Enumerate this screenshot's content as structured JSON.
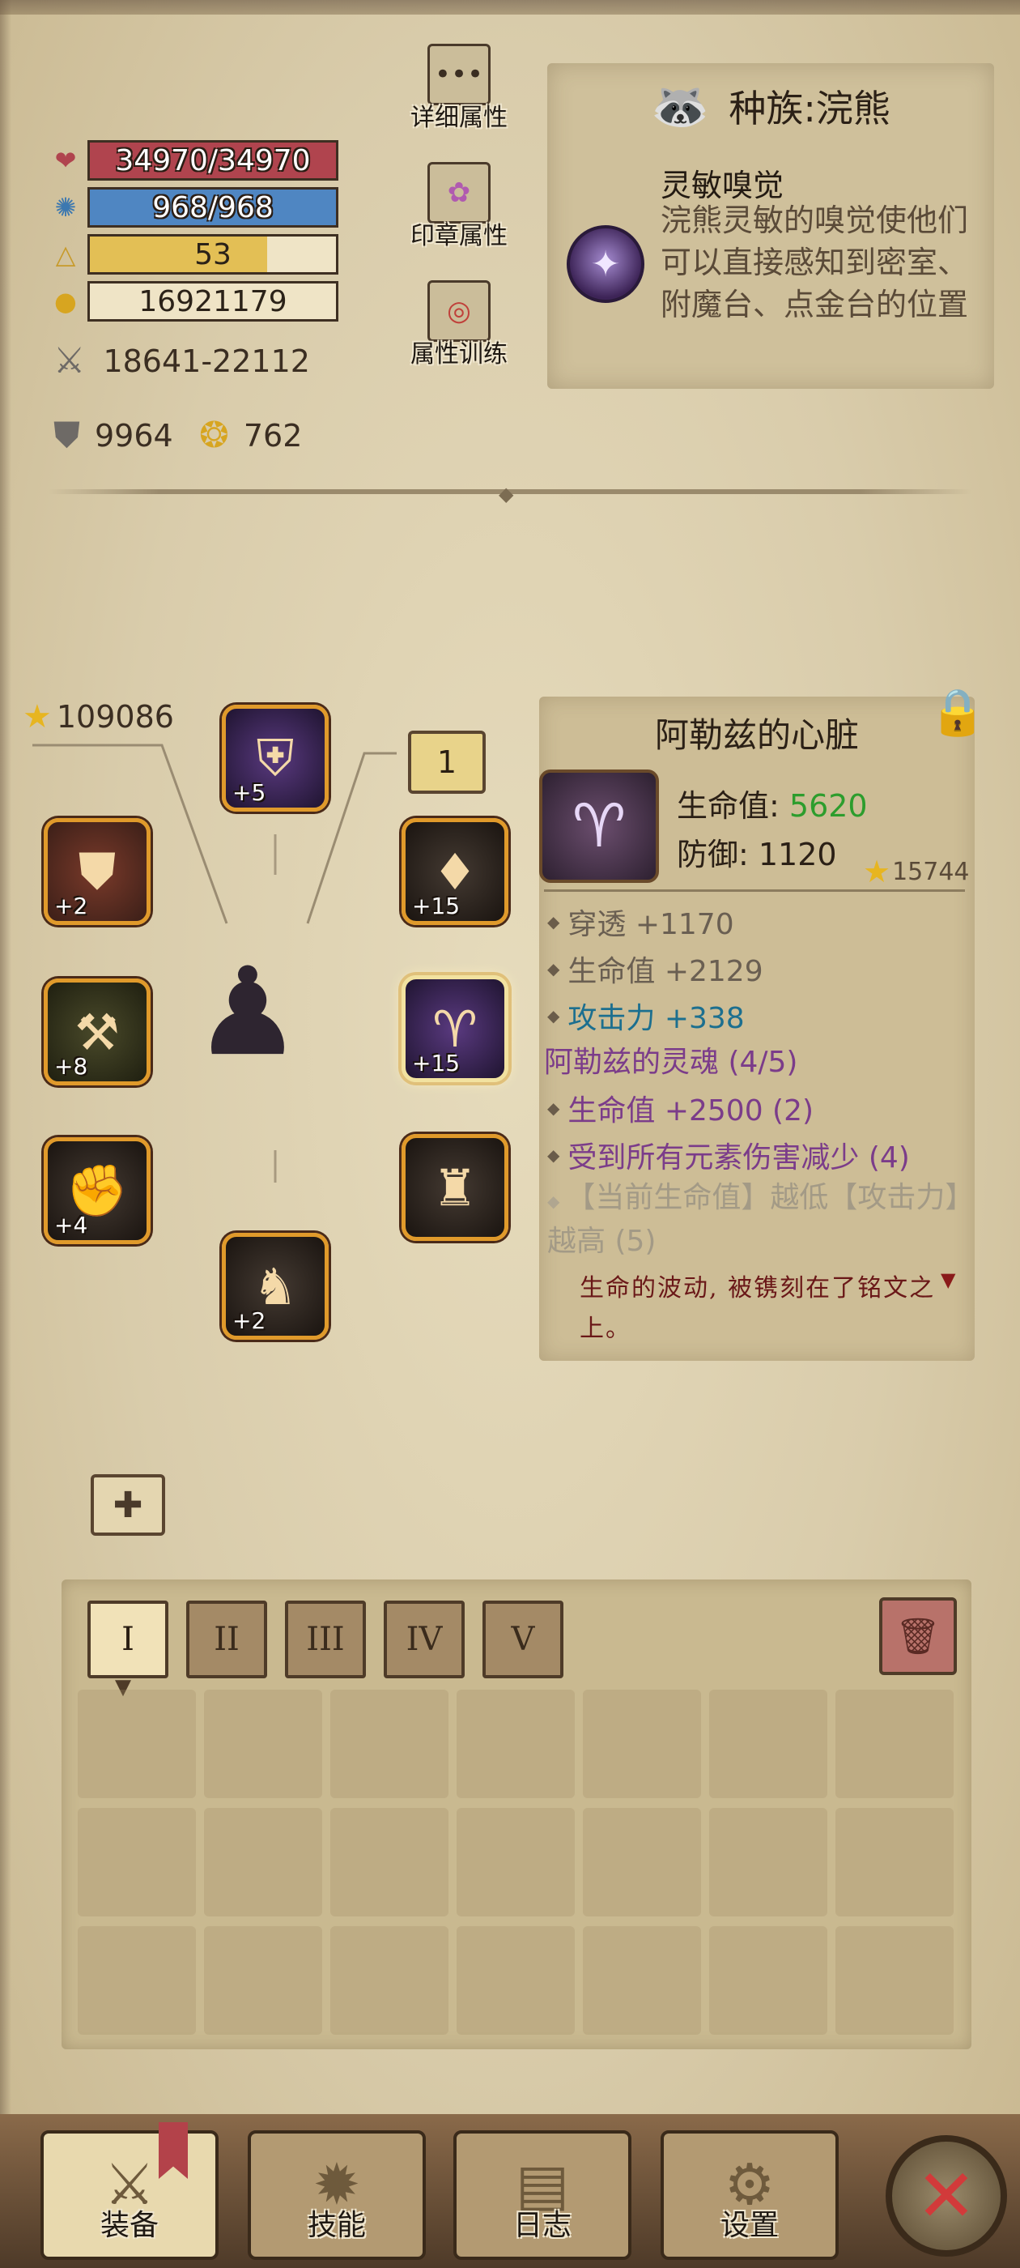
{
  "stats": {
    "hp": {
      "icon": "heart-icon",
      "text": "34970/34970",
      "fill": 1.0,
      "color": "#b0444e"
    },
    "mp": {
      "icon": "sparkle-icon",
      "text": "968/968",
      "fill": 1.0,
      "color": "#4f86c2"
    },
    "level": {
      "icon": "triangle-icon",
      "text": "53",
      "fill": 0.72,
      "color": "#e3bf55"
    },
    "gold": {
      "icon": "gold-icon",
      "text": "16921179"
    },
    "attack": {
      "icon": "crossed-swords-icon",
      "text": "18641-22112"
    },
    "defense": {
      "icon": "shield-icon",
      "text": "9964"
    },
    "crit": {
      "icon": "coin-flame-icon",
      "text": "762"
    }
  },
  "side_buttons": {
    "detail": {
      "label": "详细属性",
      "icon": "dots-icon"
    },
    "seal": {
      "label": "印章属性",
      "icon": "flower-seal-icon"
    },
    "train": {
      "label": "属性训练",
      "icon": "target-icon"
    }
  },
  "race": {
    "title": "种族:浣熊",
    "icon": "raccoon-icon",
    "skill_name": "灵敏嗅觉",
    "skill_desc": "浣熊灵敏的嗅觉使他们可以直接感知到密室、附魔台、点金台的位置"
  },
  "equipment": {
    "score": "109086",
    "slot_number": "1",
    "slots": [
      {
        "name": "helmet",
        "level": "+5",
        "style": "purple"
      },
      {
        "name": "armor",
        "level": "+2",
        "style": "red"
      },
      {
        "name": "weapon",
        "level": "+8",
        "style": "green"
      },
      {
        "name": "gauntlet",
        "level": "+4",
        "style": "dark"
      },
      {
        "name": "boots",
        "level": "+2",
        "style": "dark"
      },
      {
        "name": "shoulder",
        "level": "+15",
        "style": "dark"
      },
      {
        "name": "heart",
        "level": "+15",
        "style": "purple"
      },
      {
        "name": "cloak",
        "level": "",
        "style": "dark"
      }
    ]
  },
  "item": {
    "title": "阿勒兹的心脏",
    "hp_label": "生命值: ",
    "hp_value": "5620",
    "def_label": "防御: 1120",
    "score": "15744",
    "affixes": [
      {
        "text": "穿透 +1170",
        "color": "gray"
      },
      {
        "text": "生命值 +2129",
        "color": "gray"
      },
      {
        "text": "攻击力 +338",
        "color": "blue"
      }
    ],
    "set_name": "阿勒兹的灵魂 (4/5)",
    "set_bonuses": [
      {
        "text": "生命值 +2500 (2)",
        "color": "purple"
      },
      {
        "text": "受到所有元素伤害减少 (4)",
        "color": "purple"
      }
    ],
    "set_locked": "【当前生命值】越低【攻击力】越高 (5)",
    "flavor": "生命的波动, 被镌刻在了铭文之上。"
  },
  "inventory": {
    "tabs": [
      "I",
      "II",
      "III",
      "IV",
      "V"
    ],
    "active_tab": 0
  },
  "nav": {
    "equip": "装备",
    "skill": "技能",
    "log": "日志",
    "settings": "设置"
  }
}
